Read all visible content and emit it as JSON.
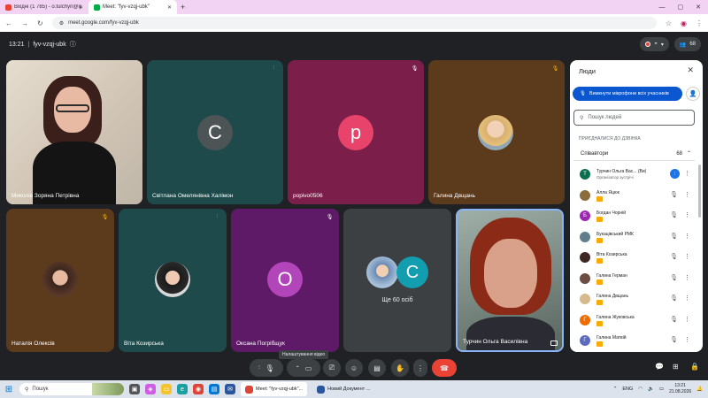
{
  "browser": {
    "tabs": [
      {
        "label": "Вхідні (1 785) - o.tulchyn@ipp...",
        "icon": "gmail-icon",
        "active": false
      },
      {
        "label": "Meet: \"fyv-vzqj-ubk\"",
        "icon": "meet-icon",
        "active": true
      }
    ],
    "new_tab": "+",
    "url": "meet.google.com/fyv-vzqj-ubk"
  },
  "meeting": {
    "time": "13:21",
    "separator": "|",
    "code": "fyv-vzqj-ubk",
    "participants_badge": "68"
  },
  "tiles": [
    {
      "name": "Миколів Зоряна Петрівна",
      "kind": "video",
      "bg": "#d9cdbd"
    },
    {
      "name": "Світлана Омелянівна Халімон",
      "kind": "letter",
      "letter": "С",
      "bg": "#1e4a4b",
      "avatar": "#4d5456"
    },
    {
      "name": "popivo0506",
      "kind": "letter",
      "letter": "p",
      "bg": "#7b1e4a",
      "avatar": "#e8446b"
    },
    {
      "name": "Галина Двщань",
      "kind": "photo",
      "bg": "#5c3a1c"
    },
    {
      "name": "Наталія Олексів",
      "kind": "photo",
      "bg": "#5c3a1c"
    },
    {
      "name": "Віта Козирська",
      "kind": "photo",
      "bg": "#1e4a4b"
    },
    {
      "name": "Оксана Погрібщук",
      "kind": "letter",
      "letter": "О",
      "bg": "#5e1a66",
      "avatar": "#b245b9"
    },
    {
      "name": "Ще 60 осіб",
      "kind": "more",
      "letter": "С",
      "bg": "#3c4043",
      "avatar": "#129eaf"
    },
    {
      "name": "Турчин Ольга Василівна",
      "kind": "video",
      "bg": "#6d7b6e"
    }
  ],
  "panel": {
    "title": "Люди",
    "mute_all": "Вимкнути мікрофони всіх учасників",
    "search_placeholder": "Пошук людей",
    "section": "ПРИЄДНАЛИСЯ ДО ДЗВІНКА",
    "group": "Співавтори",
    "group_count": "68",
    "people": [
      {
        "name": "Турчин Ольга Вас... (Ви)",
        "sub": "Організатор зустрічі",
        "initial": "Т",
        "color": "#0b6e4f",
        "speaking": true
      },
      {
        "name": "Алла Яцюк",
        "sub": "",
        "initial": "",
        "color": "#8a6d3b"
      },
      {
        "name": "Богдан Чорній",
        "sub": "",
        "initial": "Б",
        "color": "#9c27b0"
      },
      {
        "name": "Букацівський РМК",
        "sub": "",
        "initial": "",
        "color": "#607d8b"
      },
      {
        "name": "Віта Козирська",
        "sub": "",
        "initial": "",
        "color": "#3e2723"
      },
      {
        "name": "Галина Герман",
        "sub": "",
        "initial": "",
        "color": "#6d4c41"
      },
      {
        "name": "Галина Двщань",
        "sub": "",
        "initial": "",
        "color": "#d7b98e"
      },
      {
        "name": "Галина Жуковська",
        "sub": "",
        "initial": "Г",
        "color": "#ef6c00"
      },
      {
        "name": "Галина Матвій",
        "sub": "",
        "initial": "Г",
        "color": "#5c6bc0"
      }
    ]
  },
  "controls": {
    "tooltip": "Налаштування відео"
  },
  "taskbar": {
    "search": "Пошук",
    "apps": [
      {
        "label": "Meet: \"fyv-vzqj-ubk\"...",
        "icon": "chrome-icon"
      },
      {
        "label": "Новий Документ ...",
        "icon": "word-icon"
      }
    ],
    "lang": "ENG",
    "time": "13:21",
    "date": "21.08.2026"
  }
}
